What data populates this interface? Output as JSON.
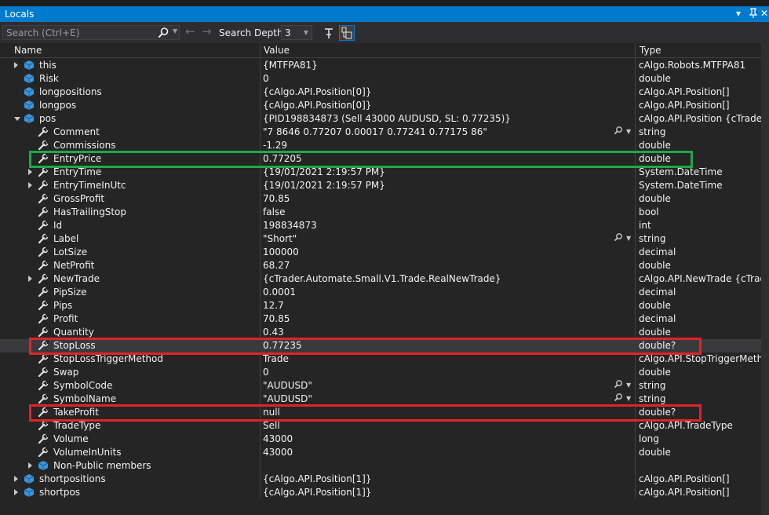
{
  "window": {
    "title": "Locals",
    "controls": [
      "▾",
      "📌",
      "✕"
    ]
  },
  "toolbar": {
    "search_placeholder": "Search (Ctrl+E)",
    "depth_label": "Search Depth:",
    "depth_value": "3"
  },
  "columns": {
    "name": "Name",
    "value": "Value",
    "type": "Type"
  },
  "rows": [
    {
      "name": "this",
      "value": "{MTFPA81}",
      "type": "cAlgo.Robots.MTFPA81",
      "indent": 0,
      "expander": "closed",
      "icon": "field"
    },
    {
      "name": "Risk",
      "value": "0",
      "type": "double",
      "indent": 0,
      "expander": "",
      "icon": "field"
    },
    {
      "name": "longpositions",
      "value": "{cAlgo.API.Position[0]}",
      "type": "cAlgo.API.Position[]",
      "indent": 0,
      "expander": "",
      "icon": "field"
    },
    {
      "name": "longpos",
      "value": "{cAlgo.API.Position[0]}",
      "type": "cAlgo.API.Position[]",
      "indent": 0,
      "expander": "",
      "icon": "field"
    },
    {
      "name": "pos",
      "value": "{PID198834873 (Sell 43000 AUDUSD, SL: 0.77235)}",
      "type": "cAlgo.API.Position {cTrader...",
      "indent": 0,
      "expander": "open",
      "icon": "field"
    },
    {
      "name": "Comment",
      "value": "\"7 8646 0.77207 0.00017 0.77241 0.77175 86\"",
      "type": "string",
      "indent": 1,
      "expander": "",
      "icon": "wrench",
      "vis": true
    },
    {
      "name": "Commissions",
      "value": "-1.29",
      "type": "double",
      "indent": 1,
      "expander": "",
      "icon": "wrench"
    },
    {
      "name": "EntryPrice",
      "value": "0.77205",
      "type": "double",
      "indent": 1,
      "expander": "",
      "icon": "wrench"
    },
    {
      "name": "EntryTime",
      "value": "{19/01/2021 2:19:57 PM}",
      "type": "System.DateTime",
      "indent": 1,
      "expander": "closed",
      "icon": "wrench"
    },
    {
      "name": "EntryTimeInUtc",
      "value": "{19/01/2021 2:19:57 PM}",
      "type": "System.DateTime",
      "indent": 1,
      "expander": "closed",
      "icon": "wrench"
    },
    {
      "name": "GrossProfit",
      "value": "70.85",
      "type": "double",
      "indent": 1,
      "expander": "",
      "icon": "wrench"
    },
    {
      "name": "HasTrailingStop",
      "value": "false",
      "type": "bool",
      "indent": 1,
      "expander": "",
      "icon": "wrench"
    },
    {
      "name": "Id",
      "value": "198834873",
      "type": "int",
      "indent": 1,
      "expander": "",
      "icon": "wrench"
    },
    {
      "name": "Label",
      "value": "\"Short\"",
      "type": "string",
      "indent": 1,
      "expander": "",
      "icon": "wrench",
      "vis": true
    },
    {
      "name": "LotSize",
      "value": "100000",
      "type": "decimal",
      "indent": 1,
      "expander": "",
      "icon": "wrench"
    },
    {
      "name": "NetProfit",
      "value": "68.27",
      "type": "double",
      "indent": 1,
      "expander": "",
      "icon": "wrench"
    },
    {
      "name": "NewTrade",
      "value": "{cTrader.Automate.Small.V1.Trade.RealNewTrade}",
      "type": "cAlgo.API.NewTrade {cTrad...",
      "indent": 1,
      "expander": "closed",
      "icon": "wrench"
    },
    {
      "name": "PipSize",
      "value": "0.0001",
      "type": "decimal",
      "indent": 1,
      "expander": "",
      "icon": "wrench"
    },
    {
      "name": "Pips",
      "value": "12.7",
      "type": "double",
      "indent": 1,
      "expander": "",
      "icon": "wrench"
    },
    {
      "name": "Profit",
      "value": "70.85",
      "type": "decimal",
      "indent": 1,
      "expander": "",
      "icon": "wrench"
    },
    {
      "name": "Quantity",
      "value": "0.43",
      "type": "double",
      "indent": 1,
      "expander": "",
      "icon": "wrench"
    },
    {
      "name": "StopLoss",
      "value": "0.77235",
      "type": "double?",
      "indent": 1,
      "expander": "",
      "icon": "wrench",
      "highlight": true
    },
    {
      "name": "StopLossTriggerMethod",
      "value": "Trade",
      "type": "cAlgo.API.StopTriggerMeth...",
      "indent": 1,
      "expander": "",
      "icon": "wrench"
    },
    {
      "name": "Swap",
      "value": "0",
      "type": "double",
      "indent": 1,
      "expander": "",
      "icon": "wrench"
    },
    {
      "name": "SymbolCode",
      "value": "\"AUDUSD\"",
      "type": "string",
      "indent": 1,
      "expander": "",
      "icon": "wrench",
      "vis": true
    },
    {
      "name": "SymbolName",
      "value": "\"AUDUSD\"",
      "type": "string",
      "indent": 1,
      "expander": "",
      "icon": "wrench",
      "vis": true
    },
    {
      "name": "TakeProfit",
      "value": "null",
      "type": "double?",
      "indent": 1,
      "expander": "",
      "icon": "wrench"
    },
    {
      "name": "TradeType",
      "value": "Sell",
      "type": "cAlgo.API.TradeType",
      "indent": 1,
      "expander": "",
      "icon": "wrench"
    },
    {
      "name": "Volume",
      "value": "43000",
      "type": "long",
      "indent": 1,
      "expander": "",
      "icon": "wrench"
    },
    {
      "name": "VolumeInUnits",
      "value": "43000",
      "type": "double",
      "indent": 1,
      "expander": "",
      "icon": "wrench"
    },
    {
      "name": "Non-Public members",
      "value": "",
      "type": "",
      "indent": 1,
      "expander": "closed",
      "icon": "field"
    },
    {
      "name": "shortpositions",
      "value": "{cAlgo.API.Position[1]}",
      "type": "cAlgo.API.Position[]",
      "indent": 0,
      "expander": "closed",
      "icon": "field"
    },
    {
      "name": "shortpos",
      "value": "{cAlgo.API.Position[1]}",
      "type": "cAlgo.API.Position[]",
      "indent": 0,
      "expander": "closed",
      "icon": "field"
    }
  ],
  "colors": {
    "accent": "#007acc",
    "highlight_green": "#1fa84a",
    "highlight_red": "#e0232a"
  }
}
